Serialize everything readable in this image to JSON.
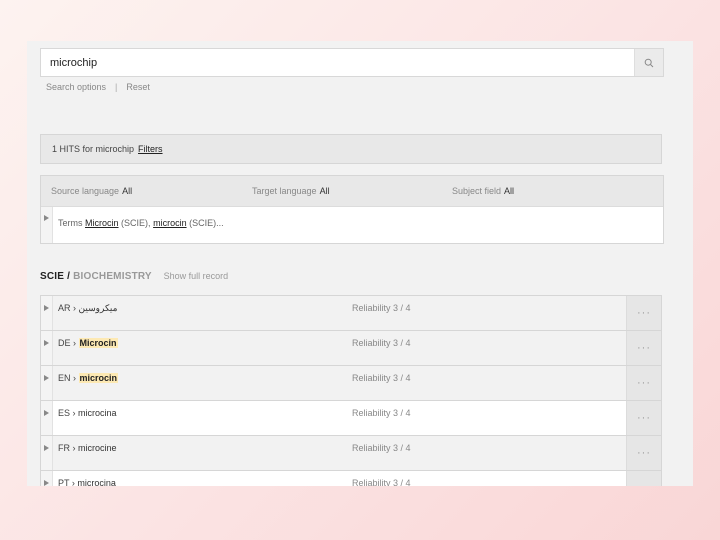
{
  "search": {
    "value": "microchip",
    "options_label": "Search options",
    "separator": "|",
    "reset_label": "Reset"
  },
  "hits": {
    "label": "1 HITS for microchip",
    "filters_label": "Filters"
  },
  "filters": [
    {
      "label": "Source language",
      "value": "All"
    },
    {
      "label": "Target language",
      "value": "All"
    },
    {
      "label": "Subject field",
      "value": "All"
    }
  ],
  "terms_row": {
    "prefix": "Terms",
    "term1": "Microcin",
    "tag1": "(SCIE),",
    "term2": "microcin",
    "tag2": "(SCIE)..."
  },
  "section": {
    "domain": "SCIE /",
    "subdomain": "BIOCHEMISTRY",
    "show_label": "Show full record"
  },
  "records": [
    {
      "lang": "AR",
      "term": "ميكروسين",
      "highlight": false,
      "reliability": "Reliability 3 / 4"
    },
    {
      "lang": "DE",
      "term": "Microcin",
      "highlight": true,
      "reliability": "Reliability 3 / 4"
    },
    {
      "lang": "EN",
      "term": "microcin",
      "highlight": true,
      "reliability": "Reliability 3 / 4"
    },
    {
      "lang": "ES",
      "term": "microcina",
      "highlight": false,
      "reliability": "Reliability 3 / 4"
    },
    {
      "lang": "FR",
      "term": "microcine",
      "highlight": false,
      "reliability": "Reliability 3 / 4"
    },
    {
      "lang": "PT",
      "term": "microcina",
      "highlight": false,
      "reliability": "Reliability 3 / 4"
    }
  ],
  "ui": {
    "lang_separator": "›",
    "more_glyph": "···"
  },
  "icons": {
    "search": "search-icon",
    "expand": "caret-right-icon",
    "more": "more-dots-icon"
  },
  "colors": {
    "highlight": "#fde9b3",
    "panel": "#f2f2f2"
  }
}
